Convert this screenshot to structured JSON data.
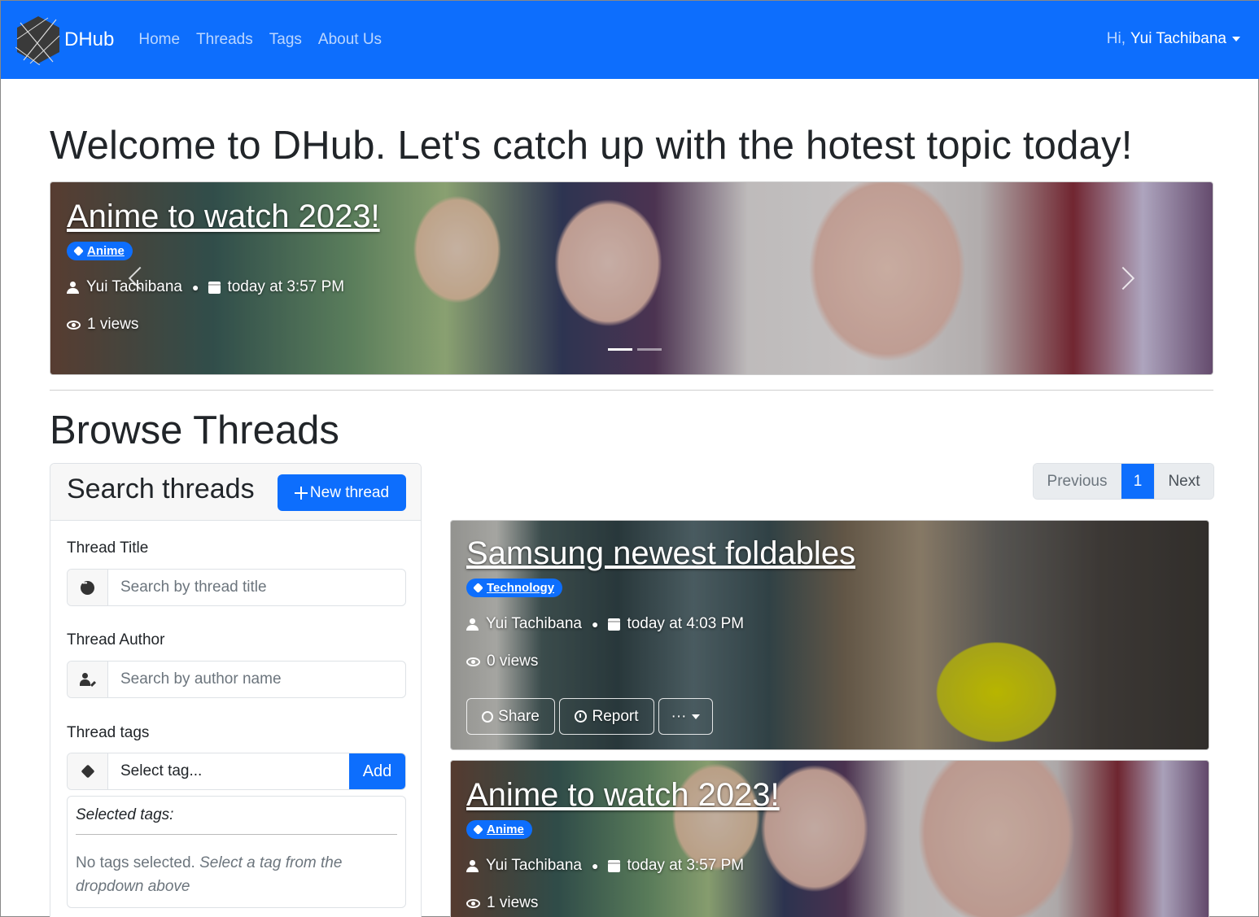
{
  "navbar": {
    "brand": "DHub",
    "links": [
      "Home",
      "Threads",
      "Tags",
      "About Us"
    ],
    "greeting": "Hi,",
    "user_name": "Yui Tachibana"
  },
  "welcome_heading": "Welcome to DHub. Let's catch up with the hotest topic today!",
  "carousel": {
    "title": "Anime to watch 2023!",
    "tag": "Anime",
    "author": "Yui Tachibana",
    "date": "today at 3:57 PM",
    "views": "1 views",
    "slide_count": 2,
    "active_slide": 1
  },
  "browse_heading": "Browse Threads",
  "search": {
    "title": "Search threads",
    "new_thread_label": "New thread",
    "thread_title_label": "Thread Title",
    "thread_title_placeholder": "Search by thread title",
    "thread_author_label": "Thread Author",
    "thread_author_placeholder": "Search by author name",
    "thread_tags_label": "Thread tags",
    "tag_select_value": "Select tag...",
    "add_label": "Add",
    "selected_tags_title": "Selected tags:",
    "no_tags_text": "No tags selected.",
    "no_tags_hint": "Select a tag from the dropdown above"
  },
  "pagination": {
    "previous": "Previous",
    "current": "1",
    "next": "Next"
  },
  "threads": [
    {
      "title": "Samsung newest foldables",
      "tag": "Technology",
      "author": "Yui Tachibana",
      "date": "today at 4:03 PM",
      "views": "0 views",
      "share_label": "Share",
      "report_label": "Report",
      "more_label": "···"
    },
    {
      "title": "Anime to watch 2023!",
      "tag": "Anime",
      "author": "Yui Tachibana",
      "date": "today at 3:57 PM",
      "views": "1 views"
    }
  ],
  "colors": {
    "primary": "#0d6efd",
    "text": "#212529",
    "muted": "#6c757d"
  }
}
